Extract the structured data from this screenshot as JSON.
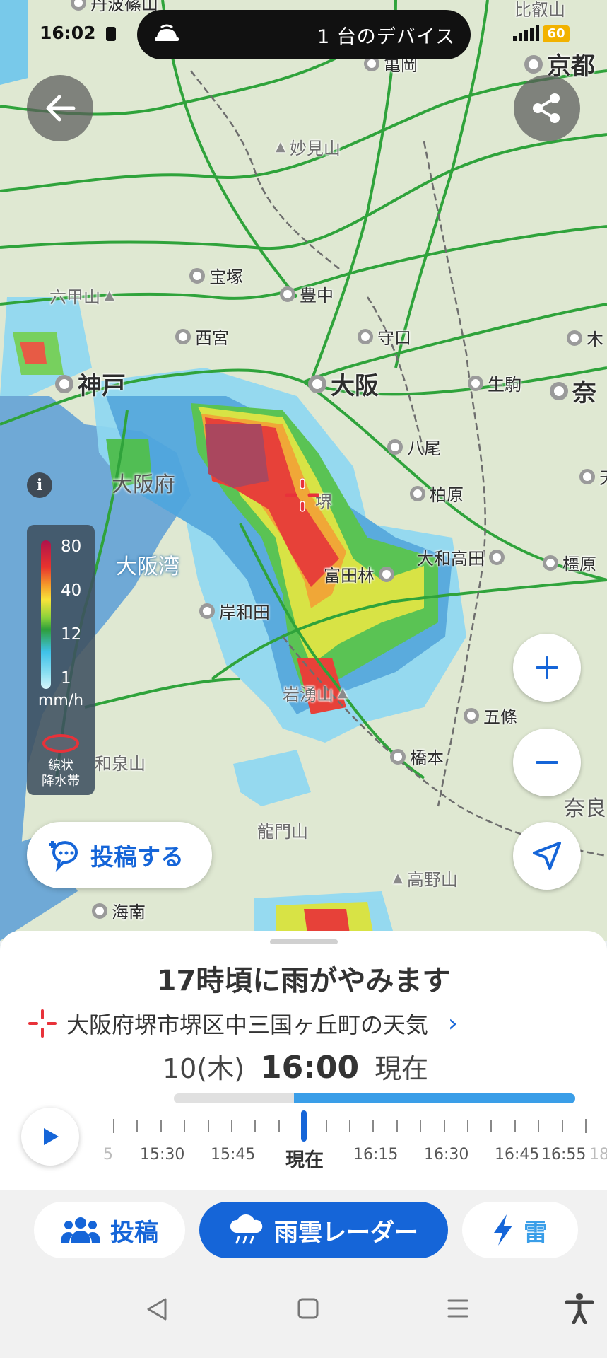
{
  "status_bar": {
    "time": "16:02",
    "media_text": "1 台のデバイス",
    "battery": "60"
  },
  "map": {
    "labels": [
      {
        "id": "tanbasasayama",
        "text": "丹波篠山",
        "dot": true,
        "cls": "small"
      },
      {
        "id": "hieizan",
        "text": "比叡山",
        "dot": false,
        "cls": "small"
      },
      {
        "id": "kameoka",
        "text": "亀岡",
        "dot": true,
        "cls": "small"
      },
      {
        "id": "kyoto",
        "text": "京都",
        "dot": true,
        "cls": "big"
      },
      {
        "id": "myokensan",
        "text": "妙見山",
        "dot": false,
        "cls": "small"
      },
      {
        "id": "takarazuka",
        "text": "宝塚",
        "dot": true,
        "cls": "small"
      },
      {
        "id": "toyonaka",
        "text": "豊中",
        "dot": true,
        "cls": "small"
      },
      {
        "id": "rokkosan",
        "text": "六甲山",
        "dot": false,
        "cls": "small"
      },
      {
        "id": "nishinomiya",
        "text": "西宮",
        "dot": true,
        "cls": "small"
      },
      {
        "id": "moriguchi",
        "text": "守口",
        "dot": true,
        "cls": "small"
      },
      {
        "id": "kizu",
        "text": "木",
        "dot": true,
        "cls": "small"
      },
      {
        "id": "kobe",
        "text": "神戸",
        "dot": true,
        "cls": "big"
      },
      {
        "id": "osaka",
        "text": "大阪",
        "dot": true,
        "cls": "big"
      },
      {
        "id": "ikoma",
        "text": "生駒",
        "dot": true,
        "cls": "small"
      },
      {
        "id": "nara",
        "text": "奈",
        "dot": true,
        "cls": "big"
      },
      {
        "id": "yao",
        "text": "八尾",
        "dot": true,
        "cls": "small"
      },
      {
        "id": "osakafu",
        "text": "大阪府",
        "dot": false,
        "cls": "region-dark"
      },
      {
        "id": "sakai",
        "text": "堺",
        "dot": false,
        "cls": "small"
      },
      {
        "id": "kashiwara",
        "text": "柏原",
        "dot": true,
        "cls": "small"
      },
      {
        "id": "tenri",
        "text": "天",
        "dot": true,
        "cls": "small"
      },
      {
        "id": "osakawan",
        "text": "大阪湾",
        "dot": false,
        "cls": "region"
      },
      {
        "id": "yamatotakada",
        "text": "大和高田",
        "dot": true,
        "cls": "small"
      },
      {
        "id": "kashihara",
        "text": "橿原",
        "dot": true,
        "cls": "small"
      },
      {
        "id": "tondabayashi",
        "text": "富田林",
        "dot": true,
        "cls": "small"
      },
      {
        "id": "kishiwada",
        "text": "岸和田",
        "dot": true,
        "cls": "small"
      },
      {
        "id": "iwawakisan",
        "text": "岩湧山",
        "dot": false,
        "cls": "small"
      },
      {
        "id": "gojo",
        "text": "五條",
        "dot": true,
        "cls": "small"
      },
      {
        "id": "hashimoto",
        "text": "橋本",
        "dot": true,
        "cls": "small"
      },
      {
        "id": "izumisan",
        "text": "和泉山",
        "dot": false,
        "cls": "small"
      },
      {
        "id": "naraken",
        "text": "奈良",
        "dot": false,
        "cls": "region-dark"
      },
      {
        "id": "ryumonzan",
        "text": "龍門山",
        "dot": false,
        "cls": "small"
      },
      {
        "id": "koyasan",
        "text": "高野山",
        "dot": false,
        "cls": "small"
      },
      {
        "id": "kainan",
        "text": "海南",
        "dot": true,
        "cls": "small"
      }
    ]
  },
  "legend": {
    "ticks": [
      "80",
      "40",
      "12",
      "1"
    ],
    "unit": "mm/h",
    "linear_band": "線状\n降水帯"
  },
  "buttons": {
    "post": "投稿する",
    "info": "i"
  },
  "sheet": {
    "headline": "17時頃に雨がやみます",
    "location": "大阪府堺市堺区中三国ヶ丘町の天気",
    "date": "10(木)",
    "time": "16:00",
    "now_suffix": "現在",
    "progress_fraction": 0.7,
    "timeline_labels": [
      "5",
      "15:30",
      "15:45",
      "現在",
      "16:15",
      "16:30",
      "16:45",
      "16:55",
      "18"
    ]
  },
  "tabs": {
    "post": "投稿",
    "radar": "雨雲レーダー",
    "thunder": "雷"
  },
  "colors": {
    "accent": "#1565d8",
    "progress": "#3a9ee8",
    "sea": "#6fa9d6",
    "rail": "#2fa33b"
  },
  "icons": [
    "back-arrow-icon",
    "share-icon",
    "plus-icon",
    "minus-icon",
    "navigation-arrow-icon",
    "location-crosshair-icon",
    "chevron-right-icon",
    "play-icon",
    "people-icon",
    "rain-cloud-icon",
    "lightning-icon",
    "back-triangle-icon",
    "home-square-icon",
    "recents-lines-icon",
    "accessibility-icon"
  ]
}
